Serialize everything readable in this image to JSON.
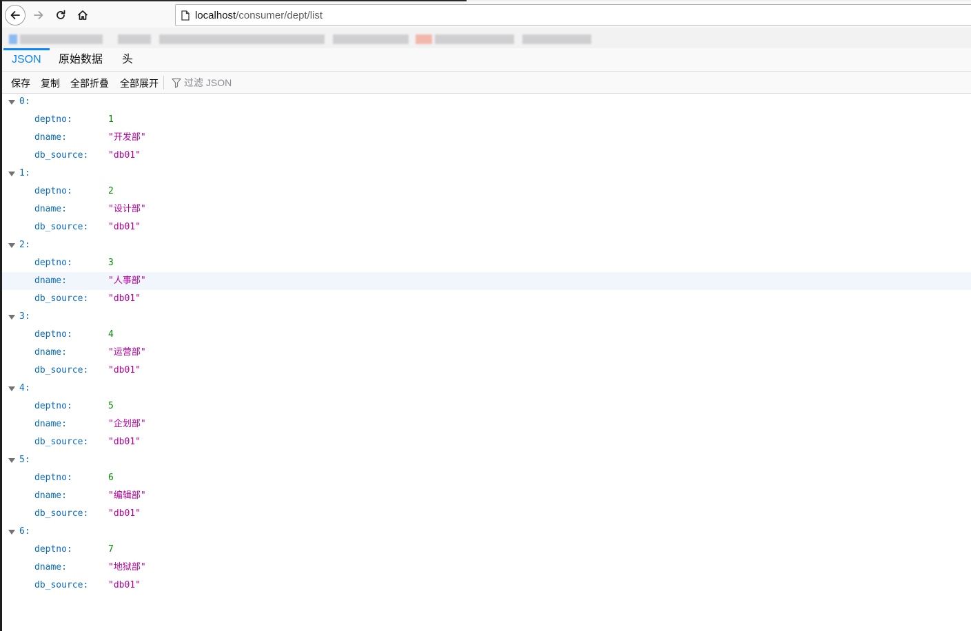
{
  "browser": {
    "url_host": "localhost",
    "url_path": "/consumer/dept/list"
  },
  "viewer": {
    "tabs": [
      "JSON",
      "原始数据",
      "头"
    ],
    "toolbar": {
      "save": "保存",
      "copy": "复制",
      "collapse_all": "全部折叠",
      "expand_all": "全部展开",
      "filter_placeholder": "过滤 JSON"
    }
  },
  "json": {
    "items": [
      {
        "index": "0:",
        "fields": [
          {
            "key": "deptno:",
            "value": "1",
            "type": "number"
          },
          {
            "key": "dname:",
            "value": "\"开发部\"",
            "type": "string"
          },
          {
            "key": "db_source:",
            "value": "\"db01\"",
            "type": "string"
          }
        ]
      },
      {
        "index": "1:",
        "fields": [
          {
            "key": "deptno:",
            "value": "2",
            "type": "number"
          },
          {
            "key": "dname:",
            "value": "\"设计部\"",
            "type": "string"
          },
          {
            "key": "db_source:",
            "value": "\"db01\"",
            "type": "string"
          }
        ]
      },
      {
        "index": "2:",
        "fields": [
          {
            "key": "deptno:",
            "value": "3",
            "type": "number"
          },
          {
            "key": "dname:",
            "value": "\"人事部\"",
            "type": "string",
            "hovered": true
          },
          {
            "key": "db_source:",
            "value": "\"db01\"",
            "type": "string"
          }
        ]
      },
      {
        "index": "3:",
        "fields": [
          {
            "key": "deptno:",
            "value": "4",
            "type": "number"
          },
          {
            "key": "dname:",
            "value": "\"运营部\"",
            "type": "string"
          },
          {
            "key": "db_source:",
            "value": "\"db01\"",
            "type": "string"
          }
        ]
      },
      {
        "index": "4:",
        "fields": [
          {
            "key": "deptno:",
            "value": "5",
            "type": "number"
          },
          {
            "key": "dname:",
            "value": "\"企划部\"",
            "type": "string"
          },
          {
            "key": "db_source:",
            "value": "\"db01\"",
            "type": "string"
          }
        ]
      },
      {
        "index": "5:",
        "fields": [
          {
            "key": "deptno:",
            "value": "6",
            "type": "number"
          },
          {
            "key": "dname:",
            "value": "\"编辑部\"",
            "type": "string"
          },
          {
            "key": "db_source:",
            "value": "\"db01\"",
            "type": "string"
          }
        ]
      },
      {
        "index": "6:",
        "fields": [
          {
            "key": "deptno:",
            "value": "7",
            "type": "number"
          },
          {
            "key": "dname:",
            "value": "\"地狱部\"",
            "type": "string"
          },
          {
            "key": "db_source:",
            "value": "\"db01\"",
            "type": "string"
          }
        ]
      }
    ]
  },
  "colors": {
    "accent": "#0a84ff",
    "key": "#0a6cbf",
    "number": "#058b00",
    "string": "#b5009d"
  }
}
